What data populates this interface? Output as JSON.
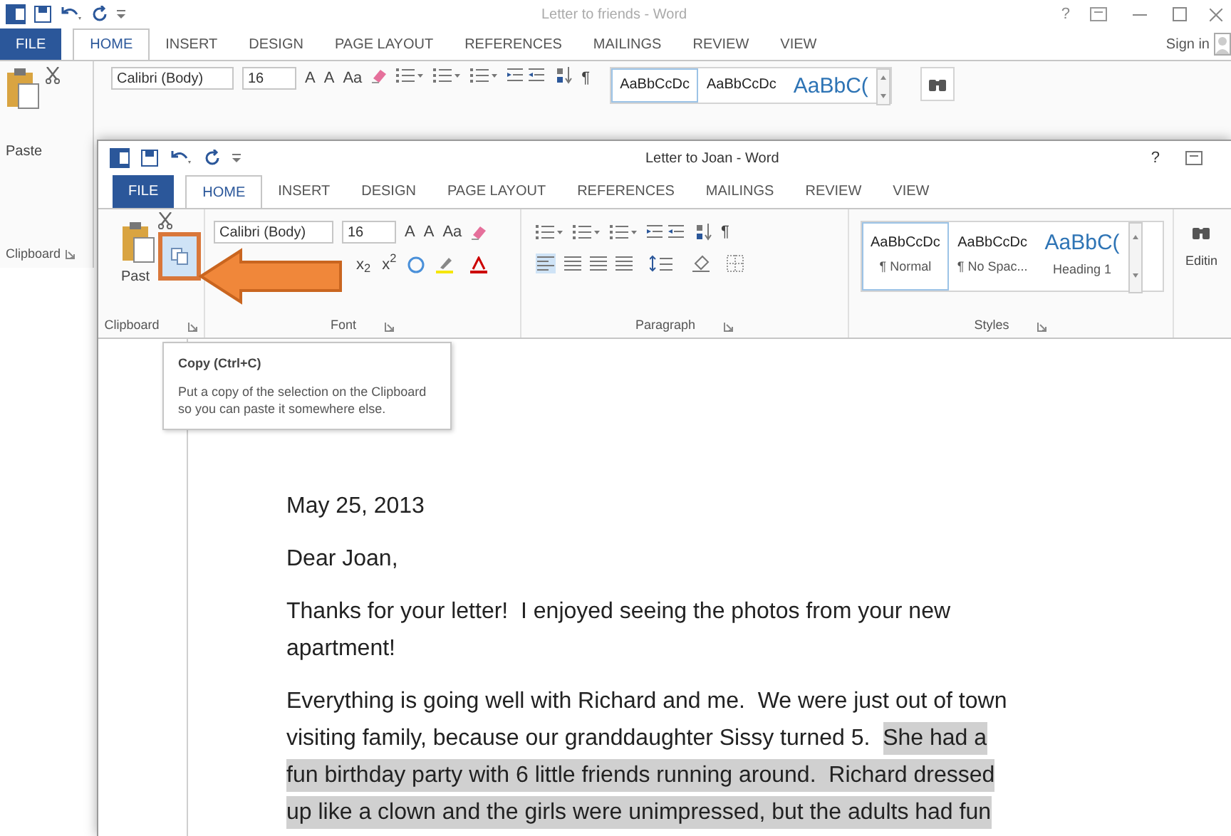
{
  "back_window": {
    "title": "Letter to friends - Word",
    "help": "?",
    "file_tab": "FILE",
    "tabs": [
      {
        "label": "HOME",
        "selected": true
      },
      {
        "label": "INSERT",
        "selected": false
      },
      {
        "label": "DESIGN",
        "selected": false
      },
      {
        "label": "PAGE LAYOUT",
        "selected": false
      },
      {
        "label": "REFERENCES",
        "selected": false
      },
      {
        "label": "MAILINGS",
        "selected": false
      },
      {
        "label": "REVIEW",
        "selected": false
      },
      {
        "label": "VIEW",
        "selected": false
      }
    ],
    "sign_in": "Sign in",
    "ribbon": {
      "font_name": "Calibri (Body)",
      "font_size": "16",
      "grow_font": "A",
      "shrink_font": "A",
      "change_case": "Aa",
      "show_marks": "¶",
      "styles": [
        {
          "sample": "AaBbCcDc",
          "kind": "body",
          "selected": true
        },
        {
          "sample": "AaBbCcDc",
          "kind": "body",
          "selected": false
        },
        {
          "sample": "AaBbC(",
          "kind": "heading",
          "selected": false
        }
      ],
      "paste_label": "Paste",
      "clipboard_label": "Clipboard"
    }
  },
  "front_window": {
    "title": "Letter to Joan - Word",
    "help": "?",
    "file_tab": "FILE",
    "tabs": [
      {
        "label": "HOME",
        "selected": true
      },
      {
        "label": "INSERT",
        "selected": false
      },
      {
        "label": "DESIGN",
        "selected": false
      },
      {
        "label": "PAGE LAYOUT",
        "selected": false
      },
      {
        "label": "REFERENCES",
        "selected": false
      },
      {
        "label": "MAILINGS",
        "selected": false
      },
      {
        "label": "REVIEW",
        "selected": false
      },
      {
        "label": "VIEW",
        "selected": false
      }
    ],
    "ribbon": {
      "paste_label": "Past",
      "font_name": "Calibri (Body)",
      "font_size": "16",
      "grow_font": "A",
      "shrink_font": "A",
      "change_case": "Aa",
      "subscript": "x$_{2}$",
      "superscript": "x$^{2}$",
      "show_marks": "¶",
      "styles": [
        {
          "sample": "AaBbCcDc",
          "name": "¶ Normal",
          "kind": "body",
          "selected": true
        },
        {
          "sample": "AaBbCcDc",
          "name": "¶ No Spac...",
          "kind": "body",
          "selected": false
        },
        {
          "sample": "AaBbC(",
          "name": "Heading 1",
          "kind": "heading",
          "selected": false
        }
      ],
      "editing_label": "Editin",
      "groups": [
        "Clipboard",
        "Font",
        "Paragraph",
        "Styles"
      ]
    },
    "tooltip": {
      "title": "Copy (Ctrl+C)",
      "body": "Put a copy of the selection on the Clipboard so you can paste it somewhere else."
    },
    "document": {
      "paragraphs": [
        {
          "lines": [
            [
              {
                "text": "May 25, 2013",
                "highlighted": false
              }
            ]
          ]
        },
        {
          "lines": [
            [
              {
                "text": "Dear Joan,",
                "highlighted": false
              }
            ]
          ]
        },
        {
          "lines": [
            [
              {
                "text": "Thanks for your letter!  I enjoyed seeing the photos from your new",
                "highlighted": false
              }
            ],
            [
              {
                "text": "apartment!",
                "highlighted": false
              }
            ]
          ]
        },
        {
          "lines": [
            [
              {
                "text": "Everything is going well with Richard and me.  We were just out of town",
                "highlighted": false
              }
            ],
            [
              {
                "text": "visiting family, because our granddaughter Sissy turned 5.  ",
                "highlighted": false
              },
              {
                "text": "She had a",
                "highlighted": true
              }
            ],
            [
              {
                "text": "fun birthday party with 6 little friends running around.  Richard dressed",
                "highlighted": true
              }
            ],
            [
              {
                "text": "up like a clown and the girls were unimpressed, but the adults had fun",
                "highlighted": true
              }
            ]
          ]
        }
      ]
    }
  }
}
